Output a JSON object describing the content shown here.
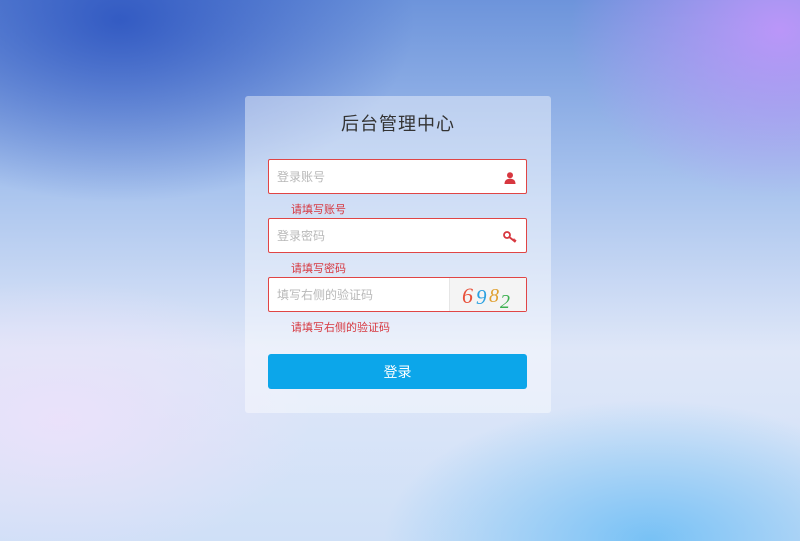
{
  "panel": {
    "title": "后台管理中心"
  },
  "account": {
    "placeholder": "登录账号",
    "value": "",
    "error": "请填写账号",
    "icon": "user-icon"
  },
  "password": {
    "placeholder": "登录密码",
    "value": "",
    "error": "请填写密码",
    "icon": "key-icon"
  },
  "captcha": {
    "placeholder": "填写右侧的验证码",
    "value": "",
    "error": "请填写右侧的验证码",
    "code": [
      "6",
      "9",
      "8",
      "2"
    ],
    "code_colors": [
      "#e8503a",
      "#2aa0e0",
      "#e0a030",
      "#3cb050"
    ]
  },
  "login_button": {
    "label": "登录",
    "color": "#0ca6ea"
  },
  "colors": {
    "error": "#d7373f",
    "field_border_error": "#e04545"
  }
}
